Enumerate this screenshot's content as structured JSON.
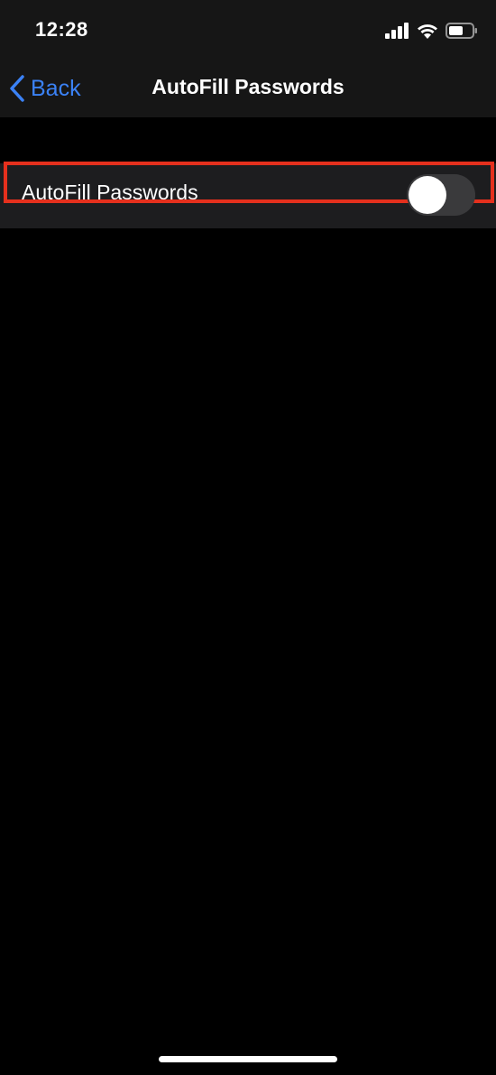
{
  "status_bar": {
    "time": "12:28",
    "icons": [
      "cellular-signal-icon",
      "wifi-icon",
      "battery-icon"
    ]
  },
  "nav": {
    "back_label": "Back",
    "title": "AutoFill Passwords"
  },
  "settings": {
    "row_label": "AutoFill Passwords",
    "toggle_on": false
  },
  "colors": {
    "accent": "#3b82f6",
    "highlight": "#e5301d",
    "background": "#000000",
    "row_background": "#1d1d1f",
    "toggle_off": "#3a3a3c"
  }
}
